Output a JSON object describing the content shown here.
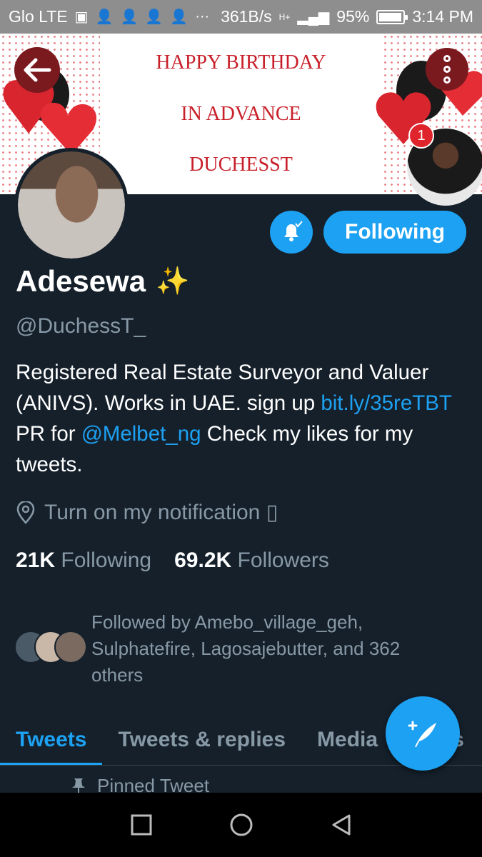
{
  "status_bar": {
    "carrier": "Glo LTE",
    "net_speed": "361B/s",
    "signal_type": "H+",
    "battery": "95%",
    "battery_level": 0.95,
    "time": "3:14 PM"
  },
  "banner": {
    "line1": "HAPPY BIRTHDAY",
    "line2": "IN ADVANCE",
    "line3": "DUCHESST",
    "notification_count": "1"
  },
  "profile": {
    "name": "Adesewa",
    "name_emoji": "✨",
    "handle": "@DuchessT_",
    "bio_part1": "Registered Real Estate Surveyor and Valuer (ANIVS). Works in UAE. sign up ",
    "bio_link1": "bit.ly/35reTBT",
    "bio_part2": " PR for ",
    "bio_link2": "@Melbet_ng",
    "bio_part3": " Check my likes for my tweets.",
    "location": "Turn on my notification ▯",
    "following_count": "21K",
    "following_label": "Following",
    "followers_count": "69.2K",
    "followers_label": "Followers",
    "followed_by": "Followed by Amebo_village_geh, Sulphatefire, Lagosajebutter, and 362 others"
  },
  "actions": {
    "following_button": "Following"
  },
  "tabs": [
    "Tweets",
    "Tweets & replies",
    "Media",
    "Likes"
  ],
  "pinned_label": "Pinned Tweet",
  "colors": {
    "background": "#15202b",
    "accent": "#1da1f2",
    "secondary_text": "#8899a6"
  },
  "icons": {
    "back": "back-arrow-icon",
    "more": "more-vertical-icon",
    "bell": "bell-icon",
    "location": "location-pin-icon",
    "compose": "compose-tweet-icon",
    "pin": "pin-icon"
  }
}
